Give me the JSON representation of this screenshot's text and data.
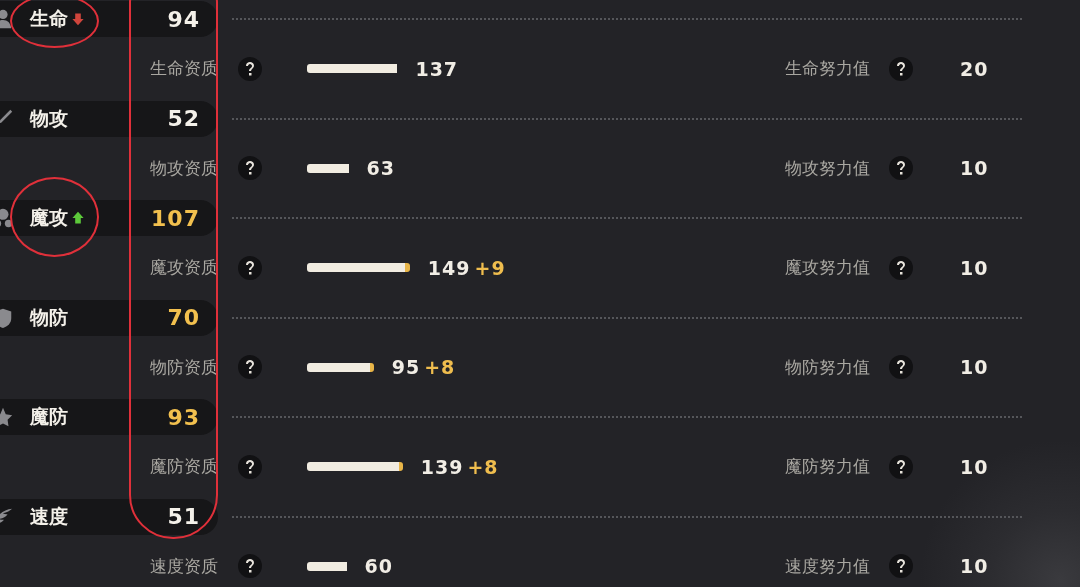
{
  "values_circled": true,
  "stats": [
    {
      "label": "生命",
      "circled": true,
      "falling": true,
      "rising": false,
      "value": "94",
      "highlighted": false,
      "aptitude_label": "生命资质",
      "aptitude": {
        "value": "137"
      },
      "effort_label": "生命努力值",
      "effort": "20"
    },
    {
      "label": "物攻",
      "circled": false,
      "falling": false,
      "rising": false,
      "value": "52",
      "highlighted": false,
      "aptitude_label": "物攻资质",
      "aptitude": {
        "value": "63"
      },
      "effort_label": "物攻努力值",
      "effort": "10"
    },
    {
      "label": "魔攻",
      "circled": true,
      "falling": false,
      "rising": true,
      "value": "107",
      "highlighted": true,
      "aptitude_label": "魔攻资质",
      "aptitude": {
        "value": "149",
        "bonus": "+9"
      },
      "effort_label": "魔攻努力值",
      "effort": "10"
    },
    {
      "label": "物防",
      "circled": false,
      "falling": false,
      "rising": false,
      "value": "70",
      "highlighted": true,
      "aptitude_label": "物防资质",
      "aptitude": {
        "value": "95",
        "bonus": "+8"
      },
      "effort_label": "物防努力值",
      "effort": "10"
    },
    {
      "label": "魔防",
      "circled": false,
      "falling": false,
      "rising": false,
      "value": "93",
      "highlighted": true,
      "aptitude_label": "魔防资质",
      "aptitude": {
        "value": "139",
        "bonus": "+8"
      },
      "effort_label": "魔防努力值",
      "effort": "10"
    },
    {
      "label": "速度",
      "circled": false,
      "falling": false,
      "rising": false,
      "value": "51",
      "highlighted": false,
      "aptitude_label": "速度资质",
      "aptitude": {
        "value": "60"
      },
      "effort_label": "速度努力值",
      "effort": "10"
    }
  ]
}
